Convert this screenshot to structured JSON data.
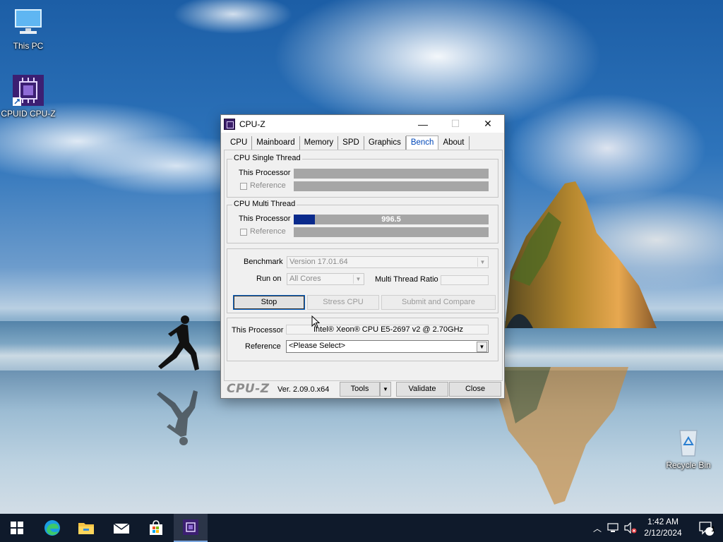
{
  "desktop": {
    "icons": [
      {
        "label": "This PC",
        "icon": "monitor-icon"
      },
      {
        "label": "CPUID CPU-Z",
        "icon": "cpuz-app-icon"
      },
      {
        "label": "Recycle Bin",
        "icon": "recycle-bin-icon"
      }
    ]
  },
  "window": {
    "title": "CPU-Z",
    "controls": {
      "minimize": "—",
      "maximize": "☐",
      "close": "✕"
    },
    "tabs": [
      "CPU",
      "Mainboard",
      "Memory",
      "SPD",
      "Graphics",
      "Bench",
      "About"
    ],
    "active_tab": "Bench",
    "single_thread": {
      "title": "CPU Single Thread",
      "this_processor": "This Processor",
      "reference": "Reference"
    },
    "multi_thread": {
      "title": "CPU Multi Thread",
      "this_processor": "This Processor",
      "reference": "Reference",
      "score": "996.5",
      "progress_fraction": 0.11
    },
    "benchmark": {
      "label": "Benchmark",
      "value": "Version 17.01.64",
      "run_on_label": "Run on",
      "run_on_value": "All Cores",
      "ratio_label": "Multi Thread Ratio",
      "ratio_value": ""
    },
    "buttons": {
      "stop": "Stop",
      "stress": "Stress CPU",
      "submit": "Submit and Compare"
    },
    "info": {
      "processor_label": "This Processor",
      "processor_value": "Intel® Xeon® CPU E5-2697 v2 @ 2.70GHz",
      "reference_label": "Reference",
      "reference_value": "<Please Select>"
    },
    "footer": {
      "brand": "CPU-Z",
      "version": "Ver. 2.09.0.x64",
      "tools": "Tools",
      "validate": "Validate",
      "close": "Close"
    }
  },
  "taskbar": {
    "apps": [
      "start-icon",
      "edge-icon",
      "file-explorer-icon",
      "mail-icon",
      "store-icon",
      "cpuz-taskbar-icon"
    ],
    "time": "1:42 AM",
    "date": "2/12/2024",
    "notification_count": "1"
  },
  "colors": {
    "bench_bar": "#0a2a8c",
    "bar_bg": "#a6a6a6",
    "active_tab": "#0047b8",
    "taskbar": "#0f1a2b"
  }
}
